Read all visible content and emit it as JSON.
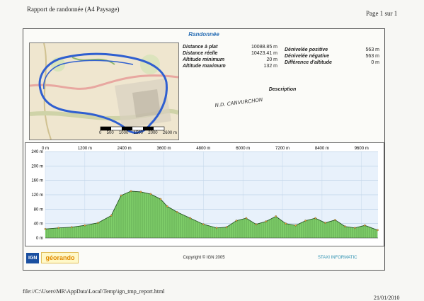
{
  "header": {
    "title": "Rapport de randonnée (A4 Paysage)",
    "page": "Page 1 sur 1"
  },
  "report": {
    "title": "Randonnée",
    "stats_left": [
      {
        "label": "Distance à plat",
        "value": "10088.85 m"
      },
      {
        "label": "Distance réelle",
        "value": "10423.41 m"
      },
      {
        "label": "Altitude minimum",
        "value": "20 m"
      },
      {
        "label": "Altitude maximum",
        "value": "132 m"
      }
    ],
    "stats_right": [
      {
        "label": "Dénivelée positive",
        "value": "563 m"
      },
      {
        "label": "Dénivelée négative",
        "value": "563 m"
      },
      {
        "label": "Différence d'altitude",
        "value": "0 m"
      }
    ],
    "description_label": "Description",
    "description_value": "N.D. CANVURCHON",
    "map_scale": {
      "labels": [
        "0",
        "500",
        "1000",
        "1500",
        "2000",
        "2600 m"
      ]
    },
    "copyright": "Copyright © IGN 2005",
    "logo_left": "géorando",
    "logo_left_badge": "IGN",
    "logo_right": "STAXI INFORMATIC"
  },
  "chart_data": {
    "type": "area",
    "title": "",
    "xlabel": "",
    "ylabel": "",
    "x_ticks": [
      "0 m",
      "1200 m",
      "2400 m",
      "3600 m",
      "4800 m",
      "6000 m",
      "7200 m",
      "8400 m",
      "9600 m"
    ],
    "y_ticks": [
      "240 m",
      "200 m",
      "160 m",
      "120 m",
      "80 m",
      "40 m",
      "0 m"
    ],
    "xlim": [
      0,
      10100
    ],
    "ylim": [
      0,
      240
    ],
    "x": [
      0,
      400,
      800,
      1200,
      1600,
      2000,
      2300,
      2600,
      2900,
      3200,
      3500,
      3700,
      4000,
      4400,
      4800,
      5200,
      5500,
      5800,
      6100,
      6400,
      6700,
      7000,
      7300,
      7600,
      7900,
      8200,
      8500,
      8800,
      9100,
      9400,
      9700,
      10088
    ],
    "values": [
      25,
      28,
      30,
      35,
      42,
      62,
      118,
      130,
      128,
      122,
      108,
      88,
      72,
      55,
      38,
      28,
      30,
      48,
      55,
      38,
      46,
      60,
      40,
      35,
      48,
      55,
      42,
      50,
      32,
      28,
      35,
      22
    ],
    "fill_color": "#7fce6a",
    "line_color": "#2e6b28",
    "grid": true
  },
  "footer": {
    "path": "file://C:\\Users\\MR\\AppData\\Local\\Temp\\ign_tmp_report.html",
    "date": "21/01/2010"
  }
}
